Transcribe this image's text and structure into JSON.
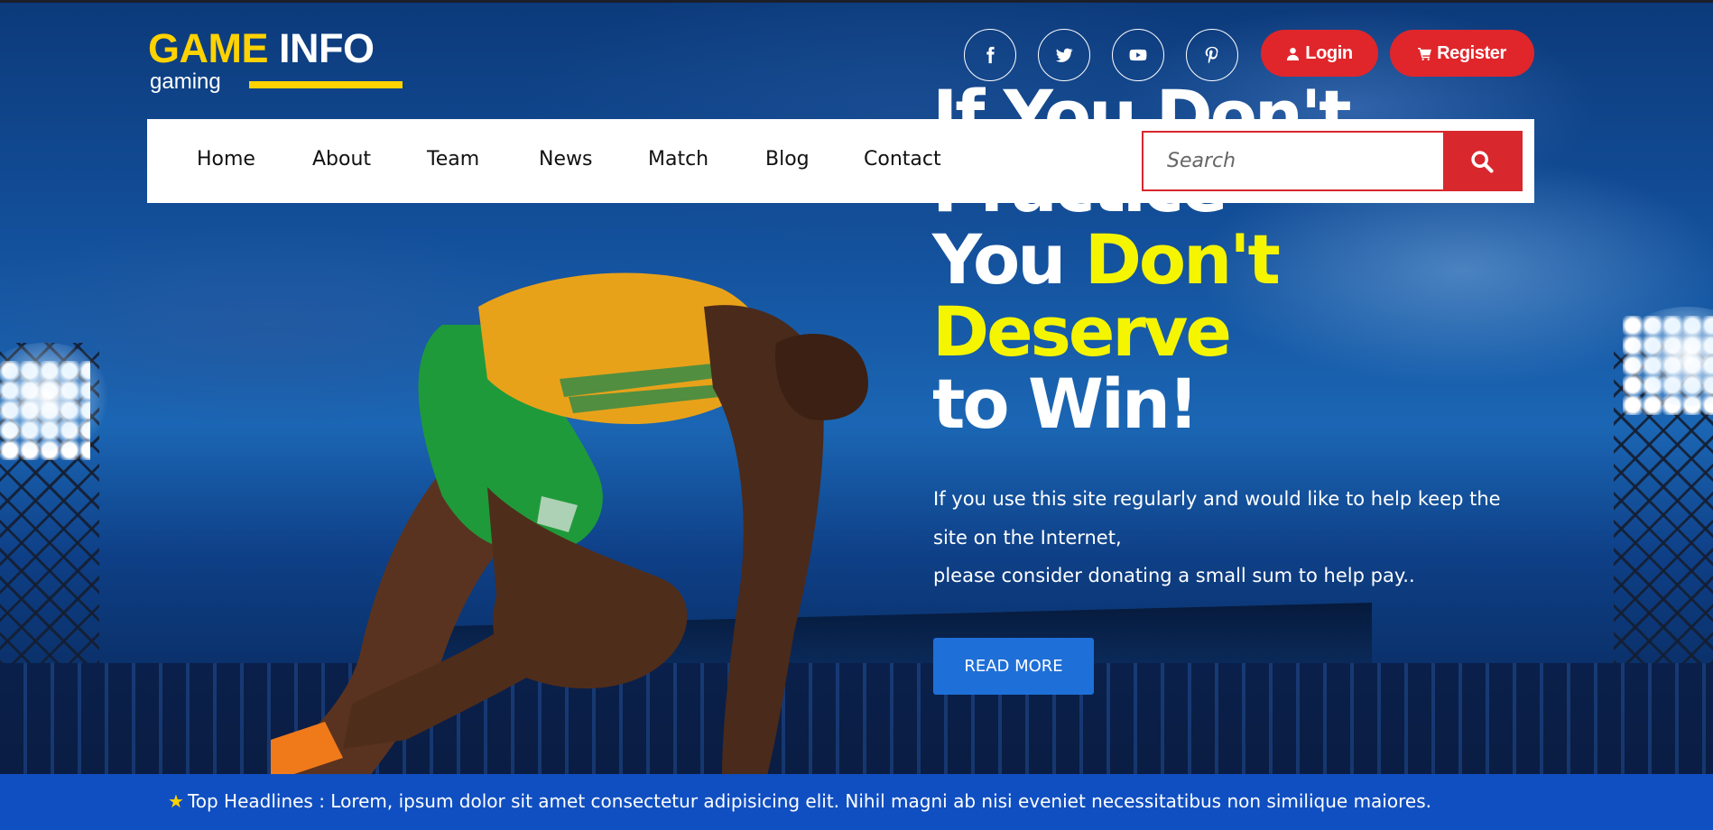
{
  "brand": {
    "name_part1": "GAME",
    "name_part2": "INFO",
    "tagline": "gaming"
  },
  "social": [
    {
      "icon": "facebook-icon"
    },
    {
      "icon": "twitter-icon"
    },
    {
      "icon": "youtube-icon"
    },
    {
      "icon": "pinterest-icon"
    }
  ],
  "auth": {
    "login_label": "Login",
    "register_label": "Register"
  },
  "nav": {
    "items": [
      "Home",
      "About",
      "Team",
      "News",
      "Match",
      "Blog",
      "Contact"
    ],
    "search_placeholder": "Search"
  },
  "hero": {
    "line1": "If You Don't",
    "line2": "Practice",
    "line3_white": "You ",
    "line3_yellow": "Don't",
    "line4": "Deserve",
    "line5": "to Win!",
    "desc_line1": "If you use this site regularly and would like to help keep the",
    "desc_line2": "site on the Internet,",
    "desc_line3": "please consider donating a small sum to help pay..",
    "cta": "READ MORE"
  },
  "ticker": {
    "text": "Top Headlines : Lorem, ipsum dolor sit amet consectetur adipisicing elit. Nihil magni ab nisi eveniet necessitatibus non similique maiores."
  },
  "colors": {
    "accent_red": "#e0262b",
    "accent_yellow": "#ffd200",
    "headline_yellow": "#f5f500",
    "button_blue": "#1f6fd8",
    "ticker_blue": "#104fc1"
  }
}
